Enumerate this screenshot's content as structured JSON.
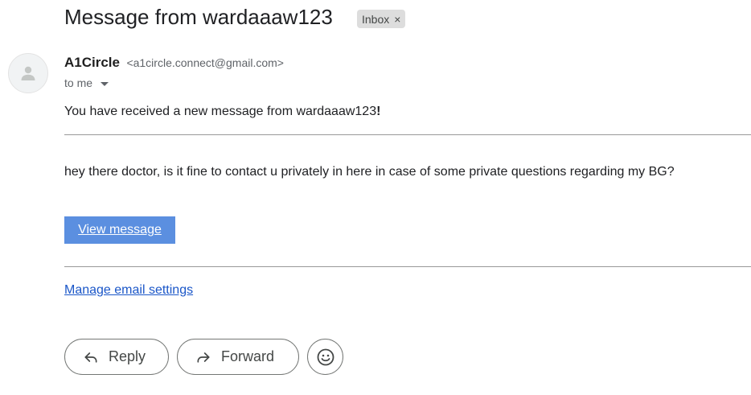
{
  "subject": "Message from wardaaaw123",
  "label": {
    "text": "Inbox",
    "remove_glyph": "×"
  },
  "sender": {
    "name": "A1Circle",
    "email": "<a1circle.connect@gmail.com>"
  },
  "recipient": {
    "text": "to me"
  },
  "body": {
    "intro_prefix": "You have received a new message from wardaaaw123",
    "intro_suffix": "!",
    "message": "hey there doctor, is it fine to contact u privately in here in case of some private questions regarding my BG?",
    "view_button": "View message",
    "manage_link": "Manage email settings"
  },
  "actions": {
    "reply": "Reply",
    "forward": "Forward"
  },
  "icons": {
    "avatar": "person-icon",
    "reply": "reply-arrow-icon",
    "forward": "forward-arrow-icon",
    "emoji": "smiley-icon",
    "dropdown": "chevron-down-icon"
  },
  "colors": {
    "button": "#5b8fe0",
    "link": "#1a56c8",
    "label_bg": "#dddddd"
  }
}
